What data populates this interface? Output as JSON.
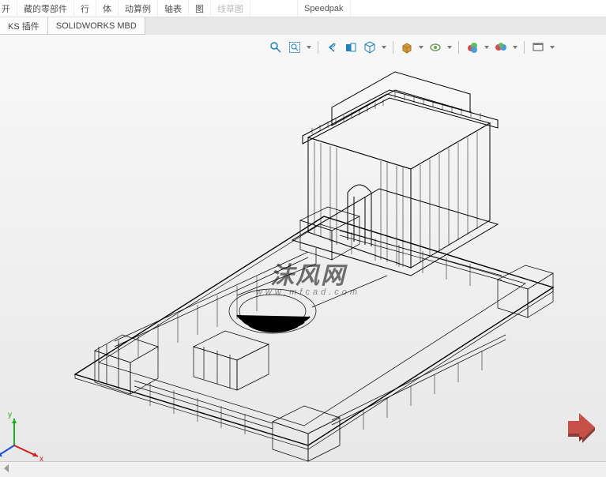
{
  "ribbon": {
    "items": [
      {
        "text": "开"
      },
      {
        "text": "藏的零部件"
      },
      {
        "text": "行"
      },
      {
        "text": "体"
      },
      {
        "text": "动算例"
      },
      {
        "text": "轴表"
      },
      {
        "text": "图"
      },
      {
        "text": "线草图"
      },
      {
        "text": ""
      },
      {
        "text": "Speedpak"
      }
    ]
  },
  "tabs": {
    "plugin": "KS 插件",
    "mbd": "SOLIDWORKS MBD"
  },
  "hud": {
    "zoom_fit": "zoom-to-fit",
    "zoom_area": "zoom-to-area",
    "prev_view": "previous-view",
    "section": "section-view",
    "view_orient": "view-orientation",
    "display_style": "display-style",
    "hide_show": "hide-show-items",
    "edit_appearance": "edit-appearance",
    "apply_scene": "apply-scene",
    "view_settings": "view-settings"
  },
  "watermark": {
    "main": "沫风网",
    "sub": "www.mfcad.com"
  },
  "triad": {
    "x": "x",
    "y": "y",
    "z": "z"
  },
  "logo": {
    "name": "solidworks-3d-logo"
  },
  "colors": {
    "zoom": "#1f7fbf",
    "cube": "#d49b3c",
    "eye": "#6fa25f",
    "rgb1": "#d84b4b",
    "rgb2": "#4b9bd8",
    "rgb3": "#5fbf5f"
  }
}
